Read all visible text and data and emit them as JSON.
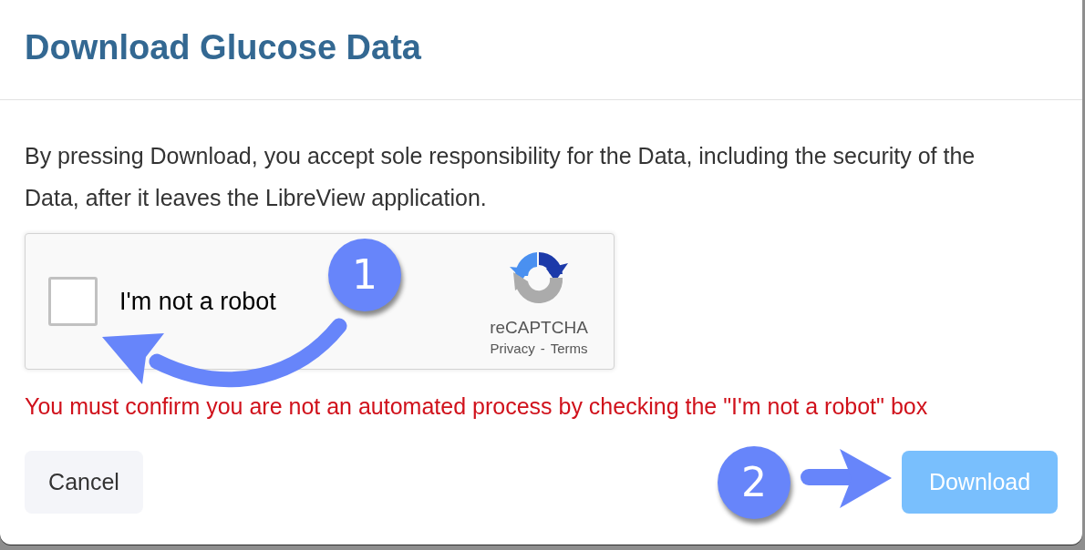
{
  "dialog": {
    "title": "Download Glucose Data"
  },
  "notice": "By pressing Download, you accept sole responsibility for the Data, including the security of the Data, after it leaves the LibreView application.",
  "captcha": {
    "label": "I'm not a robot",
    "checked": false,
    "brand": "reCAPTCHA",
    "links": [
      "Privacy",
      "Terms"
    ],
    "separator": "-"
  },
  "error": "You must confirm you are not an automated process by checking the \"I'm not a robot\" box",
  "buttons": [
    {
      "label": "Cancel",
      "kind": "secondary",
      "disabled": false
    },
    {
      "label": "Download",
      "kind": "primary",
      "disabled": true
    }
  ],
  "annotations": [
    {
      "label": "1"
    },
    {
      "label": "2"
    }
  ]
}
